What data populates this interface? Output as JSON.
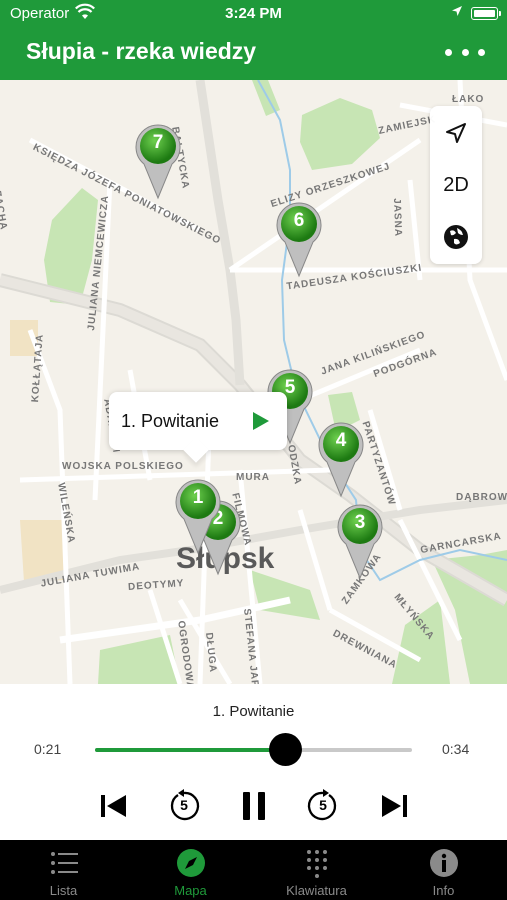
{
  "status": {
    "carrier": "Operator",
    "time": "3:24 PM"
  },
  "header": {
    "title": "Słupia - rzeka wiedzy"
  },
  "map": {
    "city": "Słupsk",
    "toggle_2d": "2D",
    "streets": {
      "baltycka": "BAŁTYCKA",
      "zamiejska": "ZAMIEJSK",
      "lako": "ŁAKO",
      "poniatowskiego": "KSIĘDZA JÓZEFA PONIATOWSKIEGO",
      "orzeszkowej": "ELIZY ORZESZKOWEJ",
      "kosciuszki": "TADEUSZA KOŚCIUSZKI",
      "jasna": "JASNA",
      "niemcewicza": "JULIANA NIEMCEWICZA",
      "adama": "ADAMA M",
      "kollataja": "KOŁŁĄTAJA",
      "kilinskiego": "JANA KILIŃSKIEGO",
      "podgorna": "PODGÓRNA",
      "wojska": "WOJSKA POLSKIEGO",
      "wilenska": "WILEŃSKA",
      "partyzantow": "PARTYZANTÓW",
      "dabrowk": "DĄBROWK",
      "garncarska": "GARNCARSKA",
      "tuwima": "JULIANA TUWIMA",
      "deotymy": "DEOTYMY",
      "zamkowa": "ZAMKOWA",
      "mlynska": "MŁYŃSKA",
      "drewniana": "DREWNIANA",
      "ogrodowa": "OGRODOWA",
      "dluga": "DŁUGA",
      "stefana": "STEFANA JARA",
      "filmowa": "FILMOWA",
      "mura": "MURA",
      "odzka": "ODZKA",
      "zacha": "ZACHA"
    },
    "pins": [
      "7",
      "6",
      "5",
      "4",
      "3",
      "2",
      "1"
    ],
    "callout_label": "1. Powitanie"
  },
  "player": {
    "title": "1. Powitanie",
    "elapsed": "0:21",
    "total": "0:34",
    "progress": 0.6,
    "skip_seconds": "5"
  },
  "tabs": [
    {
      "label": "Lista"
    },
    {
      "label": "Mapa"
    },
    {
      "label": "Klawiatura"
    },
    {
      "label": "Info"
    }
  ],
  "colors": {
    "accent": "#1f9a3a",
    "tabbar": "#000000",
    "pin_green": "#2a9a22"
  }
}
